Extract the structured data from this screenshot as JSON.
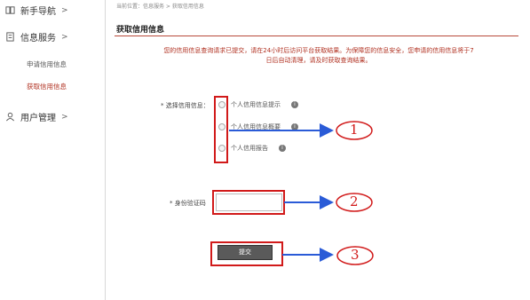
{
  "sidebar": {
    "nav_guide": "新手导航",
    "nav_info_service": "信息服务",
    "sub_apply": "申请信用信息",
    "sub_get": "获取信用信息",
    "nav_user": "用户管理",
    "chevron": ">"
  },
  "main": {
    "breadcrumb": "当前位置：信息服务 > 获取信用信息",
    "title": "获取信用信息",
    "notice_line1": "您的信用信息查询请求已提交，请在24小时后访问平台获取结果。为保障您的信息安全，您申请的信用信息将于7",
    "notice_line2": "日后自动清理，请及时获取查询结果。",
    "type_label": "* 选择信用信息：",
    "options": [
      {
        "label": "个人信用信息提示"
      },
      {
        "label": "个人信用信息概要"
      },
      {
        "label": "个人信用报告"
      }
    ],
    "info_icon": "i",
    "id_label": "* 身份验证码",
    "id_value": "",
    "submit_label": "提交"
  },
  "annotations": {
    "step1": "1",
    "step2": "2",
    "step3": "3"
  },
  "colors": {
    "accent": "#b03020",
    "highlight": "#d11a1a",
    "arrow": "#2a5bd7"
  }
}
